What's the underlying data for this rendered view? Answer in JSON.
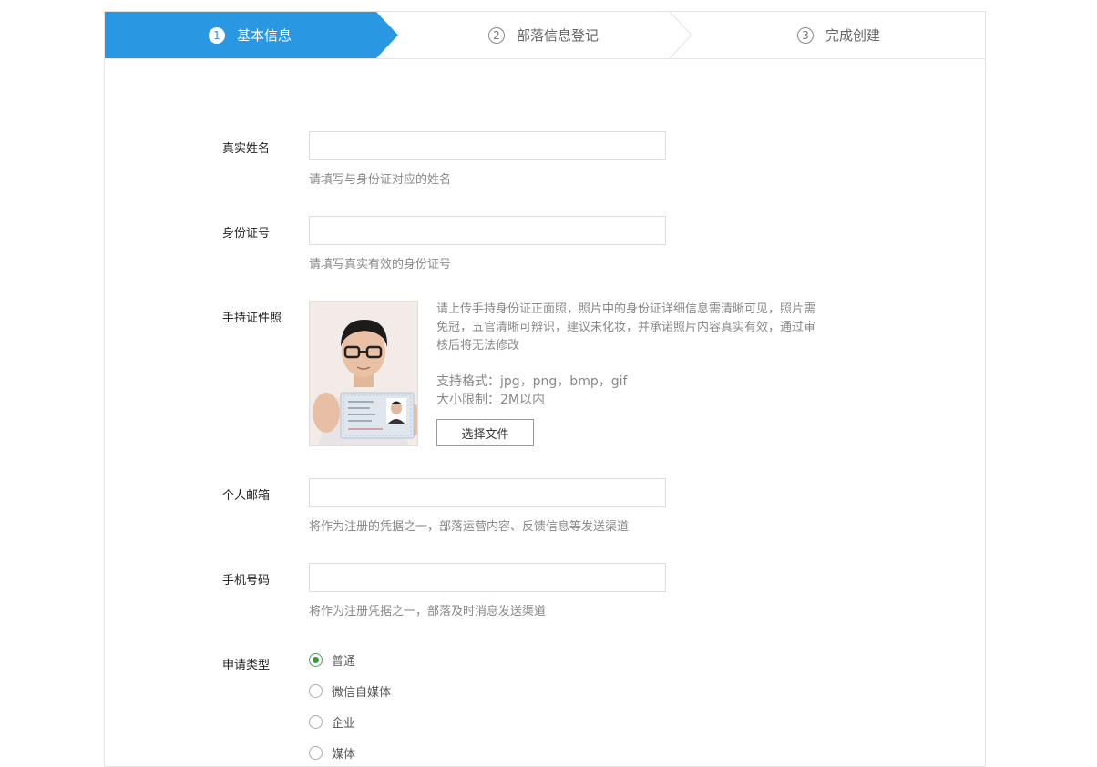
{
  "steps": [
    {
      "num": "1",
      "label": "基本信息",
      "active": true
    },
    {
      "num": "2",
      "label": "部落信息登记",
      "active": false
    },
    {
      "num": "3",
      "label": "完成创建",
      "active": false
    }
  ],
  "colors": {
    "accent": "#2a97e3",
    "radio_checked": "#3a9a3a"
  },
  "form": {
    "real_name": {
      "label": "真实姓名",
      "value": "",
      "hint": "请填写与身份证对应的姓名"
    },
    "id_number": {
      "label": "身份证号",
      "value": "",
      "hint": "请填写真实有效的身份证号"
    },
    "id_photo": {
      "label": "手持证件照",
      "description": "请上传手持身份证正面照，照片中的身份证详细信息需清晰可见，照片需免冠，五官清晰可辨识，建议未化妆，并承诺照片内容真实有效，通过审核后将无法修改",
      "formats": "支持格式：jpg，png，bmp，gif",
      "size_limit": "大小限制：2M以内",
      "button": "选择文件"
    },
    "email": {
      "label": "个人邮箱",
      "value": "",
      "hint": "将作为注册的凭据之一，部落运营内容、反馈信息等发送渠道"
    },
    "phone": {
      "label": "手机号码",
      "value": "",
      "hint": "将作为注册凭据之一，部落及时消息发送渠道"
    },
    "apply_type": {
      "label": "申请类型",
      "options": [
        "普通",
        "微信自媒体",
        "企业",
        "媒体"
      ],
      "selected": "普通"
    }
  }
}
